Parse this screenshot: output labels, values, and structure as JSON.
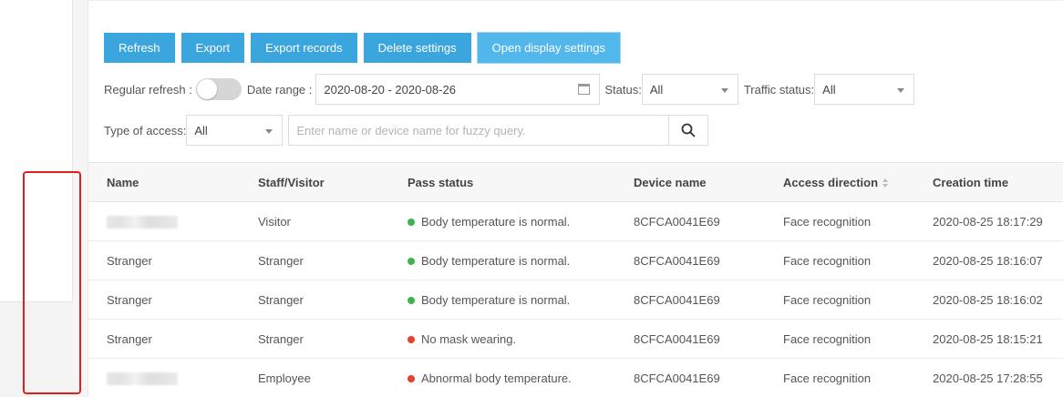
{
  "toolbar": {
    "buttons": [
      "Refresh",
      "Export",
      "Export records",
      "Delete settings",
      "Open display settings"
    ]
  },
  "filters": {
    "regular_refresh_label": "Regular refresh :",
    "date_range_label": "Date range :",
    "date_range_value": "2020-08-20 - 2020-08-26",
    "status_label": "Status:",
    "status_value": "All",
    "traffic_status_label": "Traffic status:",
    "traffic_status_value": "All",
    "type_of_access_label": "Type of access:",
    "type_of_access_value": "All",
    "search_placeholder": "Enter name or device name for fuzzy query."
  },
  "table": {
    "columns": [
      "Name",
      "Staff/Visitor",
      "Pass status",
      "Device name",
      "Access direction",
      "Creation time"
    ],
    "rows": [
      {
        "name": "",
        "staff": "Visitor",
        "status": "Body temperature is normal.",
        "status_color": "#3cb44b",
        "device": "8CFCA0041E69",
        "direction": "Face recognition",
        "time": "2020-08-25 18:17:29"
      },
      {
        "name": "Stranger",
        "staff": "Stranger",
        "status": "Body temperature is normal.",
        "status_color": "#3cb44b",
        "device": "8CFCA0041E69",
        "direction": "Face recognition",
        "time": "2020-08-25 18:16:07"
      },
      {
        "name": "Stranger",
        "staff": "Stranger",
        "status": "Body temperature is normal.",
        "status_color": "#3cb44b",
        "device": "8CFCA0041E69",
        "direction": "Face recognition",
        "time": "2020-08-25 18:16:02"
      },
      {
        "name": "Stranger",
        "staff": "Stranger",
        "status": "No mask wearing.",
        "status_color": "#e8402a",
        "device": "8CFCA0041E69",
        "direction": "Face recognition",
        "time": "2020-08-25 18:15:21"
      },
      {
        "name": "",
        "staff": "Employee",
        "status": "Abnormal body temperature.",
        "status_color": "#e8402a",
        "device": "8CFCA0041E69",
        "direction": "Face recognition",
        "time": "2020-08-25 17:28:55"
      }
    ]
  },
  "colors": {
    "primary_button": "#3aa6dd",
    "highlight_frame": "#e02020"
  }
}
